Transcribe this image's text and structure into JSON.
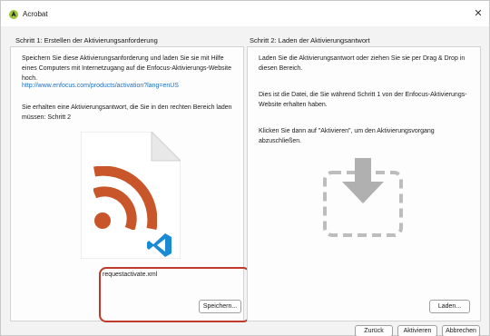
{
  "window": {
    "title": "Acrobat",
    "close_glyph": "✕"
  },
  "step1": {
    "title": "Schritt 1: Erstellen der Aktivierungsanforderung",
    "intro": "Speichern Sie diese Aktivierungsanforderung und laden Sie sie mit Hilfe eines Computers mit Internetzugang auf die Enfocus-Aktivierungs-Website hoch.",
    "link": "http://www.enfocus.com/products/activation?lang=enUS",
    "note": "Sie erhalten eine Aktivierungsantwort, die Sie in den rechten Bereich laden müssen: Schritt 2",
    "file_name": "requestactivate.xml",
    "file_icon": "rss-feed-icon",
    "badge_icon": "vscode-icon",
    "save_label": "Speichern..."
  },
  "step2": {
    "title": "Schritt 2: Laden der Aktivierungsantwort",
    "intro": "Laden Sie die Aktivierungsantwort oder ziehen Sie sie per Drag & Drop in diesen Bereich.",
    "note": "Dies ist die Datei, die Sie während Schritt 1 von der Enfocus-Aktivierungs-Website erhalten haben.",
    "instruction": "Klicken Sie dann auf \"Aktivieren\", um den Aktivierungsvorgang abzuschließen.",
    "drop_icon": "download-arrow-icon",
    "load_label": "Laden..."
  },
  "footer": {
    "back_label": "Zurück",
    "activate_label": "Aktivieren",
    "cancel_label": "Abbrechen"
  },
  "colors": {
    "rss_orange": "#c8562a",
    "link_blue": "#1f6fbf",
    "highlight_red": "#c0392b",
    "vscode_blue": "#1a8ad4"
  }
}
